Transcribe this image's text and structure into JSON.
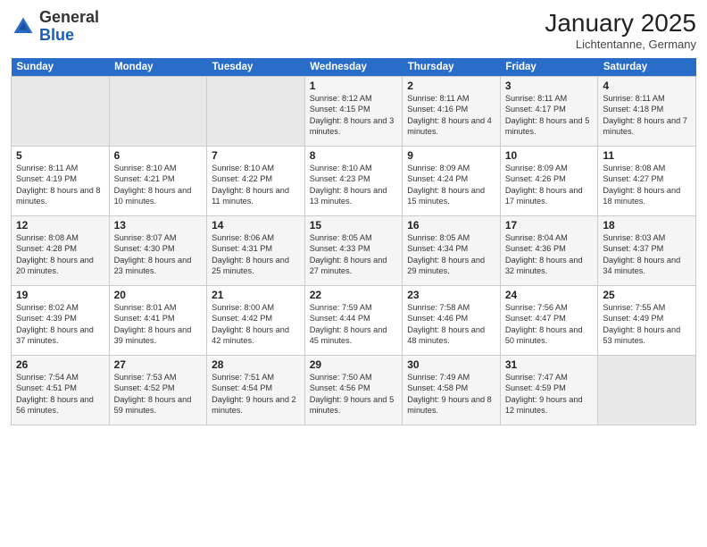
{
  "header": {
    "logo_general": "General",
    "logo_blue": "Blue",
    "month_title": "January 2025",
    "location": "Lichtentanne, Germany"
  },
  "days_of_week": [
    "Sunday",
    "Monday",
    "Tuesday",
    "Wednesday",
    "Thursday",
    "Friday",
    "Saturday"
  ],
  "weeks": [
    [
      {
        "day": "",
        "text": ""
      },
      {
        "day": "",
        "text": ""
      },
      {
        "day": "",
        "text": ""
      },
      {
        "day": "1",
        "text": "Sunrise: 8:12 AM\nSunset: 4:15 PM\nDaylight: 8 hours and 3 minutes."
      },
      {
        "day": "2",
        "text": "Sunrise: 8:11 AM\nSunset: 4:16 PM\nDaylight: 8 hours and 4 minutes."
      },
      {
        "day": "3",
        "text": "Sunrise: 8:11 AM\nSunset: 4:17 PM\nDaylight: 8 hours and 5 minutes."
      },
      {
        "day": "4",
        "text": "Sunrise: 8:11 AM\nSunset: 4:18 PM\nDaylight: 8 hours and 7 minutes."
      }
    ],
    [
      {
        "day": "5",
        "text": "Sunrise: 8:11 AM\nSunset: 4:19 PM\nDaylight: 8 hours and 8 minutes."
      },
      {
        "day": "6",
        "text": "Sunrise: 8:10 AM\nSunset: 4:21 PM\nDaylight: 8 hours and 10 minutes."
      },
      {
        "day": "7",
        "text": "Sunrise: 8:10 AM\nSunset: 4:22 PM\nDaylight: 8 hours and 11 minutes."
      },
      {
        "day": "8",
        "text": "Sunrise: 8:10 AM\nSunset: 4:23 PM\nDaylight: 8 hours and 13 minutes."
      },
      {
        "day": "9",
        "text": "Sunrise: 8:09 AM\nSunset: 4:24 PM\nDaylight: 8 hours and 15 minutes."
      },
      {
        "day": "10",
        "text": "Sunrise: 8:09 AM\nSunset: 4:26 PM\nDaylight: 8 hours and 17 minutes."
      },
      {
        "day": "11",
        "text": "Sunrise: 8:08 AM\nSunset: 4:27 PM\nDaylight: 8 hours and 18 minutes."
      }
    ],
    [
      {
        "day": "12",
        "text": "Sunrise: 8:08 AM\nSunset: 4:28 PM\nDaylight: 8 hours and 20 minutes."
      },
      {
        "day": "13",
        "text": "Sunrise: 8:07 AM\nSunset: 4:30 PM\nDaylight: 8 hours and 23 minutes."
      },
      {
        "day": "14",
        "text": "Sunrise: 8:06 AM\nSunset: 4:31 PM\nDaylight: 8 hours and 25 minutes."
      },
      {
        "day": "15",
        "text": "Sunrise: 8:05 AM\nSunset: 4:33 PM\nDaylight: 8 hours and 27 minutes."
      },
      {
        "day": "16",
        "text": "Sunrise: 8:05 AM\nSunset: 4:34 PM\nDaylight: 8 hours and 29 minutes."
      },
      {
        "day": "17",
        "text": "Sunrise: 8:04 AM\nSunset: 4:36 PM\nDaylight: 8 hours and 32 minutes."
      },
      {
        "day": "18",
        "text": "Sunrise: 8:03 AM\nSunset: 4:37 PM\nDaylight: 8 hours and 34 minutes."
      }
    ],
    [
      {
        "day": "19",
        "text": "Sunrise: 8:02 AM\nSunset: 4:39 PM\nDaylight: 8 hours and 37 minutes."
      },
      {
        "day": "20",
        "text": "Sunrise: 8:01 AM\nSunset: 4:41 PM\nDaylight: 8 hours and 39 minutes."
      },
      {
        "day": "21",
        "text": "Sunrise: 8:00 AM\nSunset: 4:42 PM\nDaylight: 8 hours and 42 minutes."
      },
      {
        "day": "22",
        "text": "Sunrise: 7:59 AM\nSunset: 4:44 PM\nDaylight: 8 hours and 45 minutes."
      },
      {
        "day": "23",
        "text": "Sunrise: 7:58 AM\nSunset: 4:46 PM\nDaylight: 8 hours and 48 minutes."
      },
      {
        "day": "24",
        "text": "Sunrise: 7:56 AM\nSunset: 4:47 PM\nDaylight: 8 hours and 50 minutes."
      },
      {
        "day": "25",
        "text": "Sunrise: 7:55 AM\nSunset: 4:49 PM\nDaylight: 8 hours and 53 minutes."
      }
    ],
    [
      {
        "day": "26",
        "text": "Sunrise: 7:54 AM\nSunset: 4:51 PM\nDaylight: 8 hours and 56 minutes."
      },
      {
        "day": "27",
        "text": "Sunrise: 7:53 AM\nSunset: 4:52 PM\nDaylight: 8 hours and 59 minutes."
      },
      {
        "day": "28",
        "text": "Sunrise: 7:51 AM\nSunset: 4:54 PM\nDaylight: 9 hours and 2 minutes."
      },
      {
        "day": "29",
        "text": "Sunrise: 7:50 AM\nSunset: 4:56 PM\nDaylight: 9 hours and 5 minutes."
      },
      {
        "day": "30",
        "text": "Sunrise: 7:49 AM\nSunset: 4:58 PM\nDaylight: 9 hours and 8 minutes."
      },
      {
        "day": "31",
        "text": "Sunrise: 7:47 AM\nSunset: 4:59 PM\nDaylight: 9 hours and 12 minutes."
      },
      {
        "day": "",
        "text": ""
      }
    ]
  ]
}
